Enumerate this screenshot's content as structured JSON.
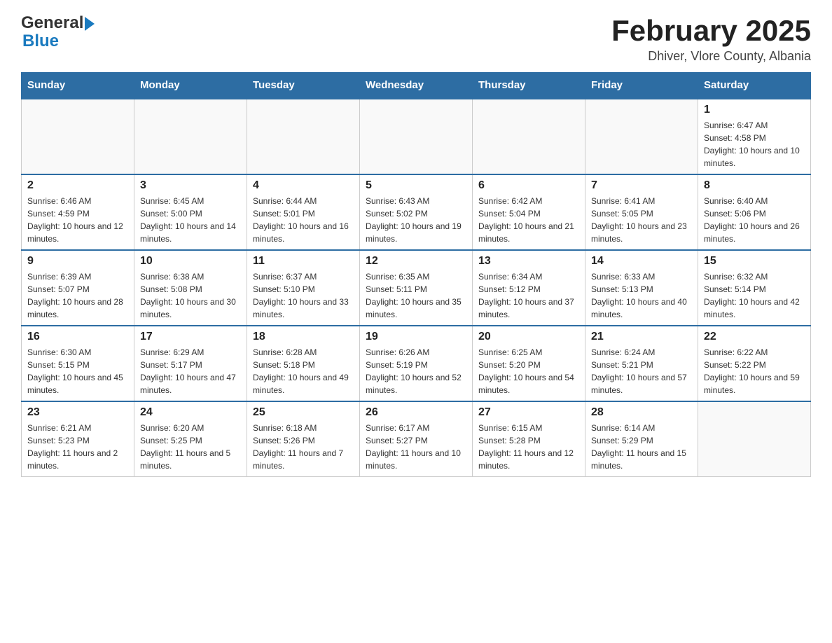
{
  "header": {
    "logo_text_general": "General",
    "logo_text_blue": "Blue",
    "calendar_title": "February 2025",
    "calendar_subtitle": "Dhiver, Vlore County, Albania"
  },
  "days_of_week": [
    "Sunday",
    "Monday",
    "Tuesday",
    "Wednesday",
    "Thursday",
    "Friday",
    "Saturday"
  ],
  "weeks": [
    [
      {
        "day": "",
        "sunrise": "",
        "sunset": "",
        "daylight": ""
      },
      {
        "day": "",
        "sunrise": "",
        "sunset": "",
        "daylight": ""
      },
      {
        "day": "",
        "sunrise": "",
        "sunset": "",
        "daylight": ""
      },
      {
        "day": "",
        "sunrise": "",
        "sunset": "",
        "daylight": ""
      },
      {
        "day": "",
        "sunrise": "",
        "sunset": "",
        "daylight": ""
      },
      {
        "day": "",
        "sunrise": "",
        "sunset": "",
        "daylight": ""
      },
      {
        "day": "1",
        "sunrise": "Sunrise: 6:47 AM",
        "sunset": "Sunset: 4:58 PM",
        "daylight": "Daylight: 10 hours and 10 minutes."
      }
    ],
    [
      {
        "day": "2",
        "sunrise": "Sunrise: 6:46 AM",
        "sunset": "Sunset: 4:59 PM",
        "daylight": "Daylight: 10 hours and 12 minutes."
      },
      {
        "day": "3",
        "sunrise": "Sunrise: 6:45 AM",
        "sunset": "Sunset: 5:00 PM",
        "daylight": "Daylight: 10 hours and 14 minutes."
      },
      {
        "day": "4",
        "sunrise": "Sunrise: 6:44 AM",
        "sunset": "Sunset: 5:01 PM",
        "daylight": "Daylight: 10 hours and 16 minutes."
      },
      {
        "day": "5",
        "sunrise": "Sunrise: 6:43 AM",
        "sunset": "Sunset: 5:02 PM",
        "daylight": "Daylight: 10 hours and 19 minutes."
      },
      {
        "day": "6",
        "sunrise": "Sunrise: 6:42 AM",
        "sunset": "Sunset: 5:04 PM",
        "daylight": "Daylight: 10 hours and 21 minutes."
      },
      {
        "day": "7",
        "sunrise": "Sunrise: 6:41 AM",
        "sunset": "Sunset: 5:05 PM",
        "daylight": "Daylight: 10 hours and 23 minutes."
      },
      {
        "day": "8",
        "sunrise": "Sunrise: 6:40 AM",
        "sunset": "Sunset: 5:06 PM",
        "daylight": "Daylight: 10 hours and 26 minutes."
      }
    ],
    [
      {
        "day": "9",
        "sunrise": "Sunrise: 6:39 AM",
        "sunset": "Sunset: 5:07 PM",
        "daylight": "Daylight: 10 hours and 28 minutes."
      },
      {
        "day": "10",
        "sunrise": "Sunrise: 6:38 AM",
        "sunset": "Sunset: 5:08 PM",
        "daylight": "Daylight: 10 hours and 30 minutes."
      },
      {
        "day": "11",
        "sunrise": "Sunrise: 6:37 AM",
        "sunset": "Sunset: 5:10 PM",
        "daylight": "Daylight: 10 hours and 33 minutes."
      },
      {
        "day": "12",
        "sunrise": "Sunrise: 6:35 AM",
        "sunset": "Sunset: 5:11 PM",
        "daylight": "Daylight: 10 hours and 35 minutes."
      },
      {
        "day": "13",
        "sunrise": "Sunrise: 6:34 AM",
        "sunset": "Sunset: 5:12 PM",
        "daylight": "Daylight: 10 hours and 37 minutes."
      },
      {
        "day": "14",
        "sunrise": "Sunrise: 6:33 AM",
        "sunset": "Sunset: 5:13 PM",
        "daylight": "Daylight: 10 hours and 40 minutes."
      },
      {
        "day": "15",
        "sunrise": "Sunrise: 6:32 AM",
        "sunset": "Sunset: 5:14 PM",
        "daylight": "Daylight: 10 hours and 42 minutes."
      }
    ],
    [
      {
        "day": "16",
        "sunrise": "Sunrise: 6:30 AM",
        "sunset": "Sunset: 5:15 PM",
        "daylight": "Daylight: 10 hours and 45 minutes."
      },
      {
        "day": "17",
        "sunrise": "Sunrise: 6:29 AM",
        "sunset": "Sunset: 5:17 PM",
        "daylight": "Daylight: 10 hours and 47 minutes."
      },
      {
        "day": "18",
        "sunrise": "Sunrise: 6:28 AM",
        "sunset": "Sunset: 5:18 PM",
        "daylight": "Daylight: 10 hours and 49 minutes."
      },
      {
        "day": "19",
        "sunrise": "Sunrise: 6:26 AM",
        "sunset": "Sunset: 5:19 PM",
        "daylight": "Daylight: 10 hours and 52 minutes."
      },
      {
        "day": "20",
        "sunrise": "Sunrise: 6:25 AM",
        "sunset": "Sunset: 5:20 PM",
        "daylight": "Daylight: 10 hours and 54 minutes."
      },
      {
        "day": "21",
        "sunrise": "Sunrise: 6:24 AM",
        "sunset": "Sunset: 5:21 PM",
        "daylight": "Daylight: 10 hours and 57 minutes."
      },
      {
        "day": "22",
        "sunrise": "Sunrise: 6:22 AM",
        "sunset": "Sunset: 5:22 PM",
        "daylight": "Daylight: 10 hours and 59 minutes."
      }
    ],
    [
      {
        "day": "23",
        "sunrise": "Sunrise: 6:21 AM",
        "sunset": "Sunset: 5:23 PM",
        "daylight": "Daylight: 11 hours and 2 minutes."
      },
      {
        "day": "24",
        "sunrise": "Sunrise: 6:20 AM",
        "sunset": "Sunset: 5:25 PM",
        "daylight": "Daylight: 11 hours and 5 minutes."
      },
      {
        "day": "25",
        "sunrise": "Sunrise: 6:18 AM",
        "sunset": "Sunset: 5:26 PM",
        "daylight": "Daylight: 11 hours and 7 minutes."
      },
      {
        "day": "26",
        "sunrise": "Sunrise: 6:17 AM",
        "sunset": "Sunset: 5:27 PM",
        "daylight": "Daylight: 11 hours and 10 minutes."
      },
      {
        "day": "27",
        "sunrise": "Sunrise: 6:15 AM",
        "sunset": "Sunset: 5:28 PM",
        "daylight": "Daylight: 11 hours and 12 minutes."
      },
      {
        "day": "28",
        "sunrise": "Sunrise: 6:14 AM",
        "sunset": "Sunset: 5:29 PM",
        "daylight": "Daylight: 11 hours and 15 minutes."
      },
      {
        "day": "",
        "sunrise": "",
        "sunset": "",
        "daylight": ""
      }
    ]
  ]
}
